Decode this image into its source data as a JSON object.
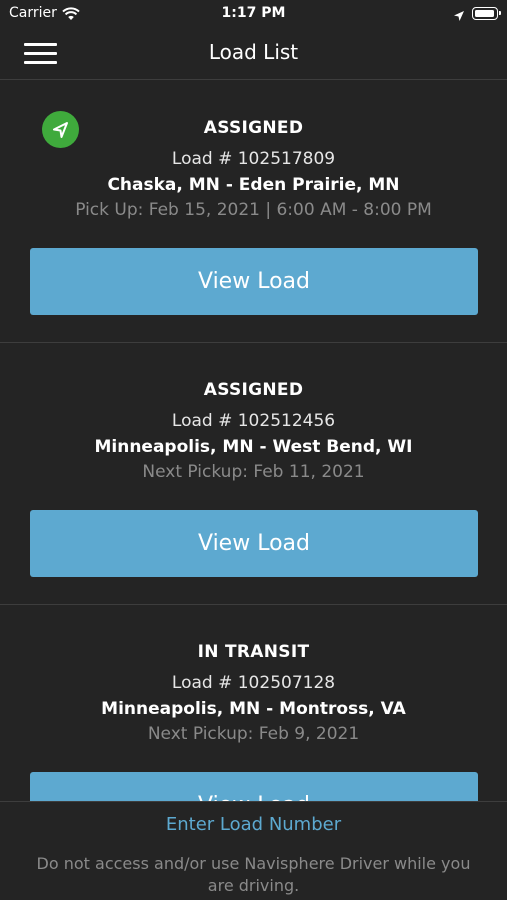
{
  "status_bar": {
    "carrier": "Carrier",
    "time": "1:17 PM"
  },
  "header": {
    "title": "Load List"
  },
  "loads": [
    {
      "status": "ASSIGNED",
      "number": "Load # 102517809",
      "route": "Chaska, MN - Eden Prairie, MN",
      "pickup": "Pick Up: Feb 15, 2021 | 6:00 AM - 8:00 PM",
      "button": "View Load"
    },
    {
      "status": "ASSIGNED",
      "number": "Load # 102512456",
      "route": "Minneapolis, MN - West Bend, WI",
      "pickup": "Next Pickup: Feb 11, 2021",
      "button": "View Load"
    },
    {
      "status": "IN TRANSIT",
      "number": "Load # 102507128",
      "route": "Minneapolis, MN - Montross, VA",
      "pickup": "Next Pickup: Feb 9, 2021",
      "button": "View Load"
    }
  ],
  "footer": {
    "link": "Enter Load Number",
    "note": "Do not access and/or use Navisphere Driver while you are driving."
  },
  "colors": {
    "accent": "#5da9d0",
    "background": "#242424",
    "badge": "#3faa3c",
    "muted": "#8a8a8a"
  },
  "icons": {
    "menu": "hamburger-icon",
    "active_load": "navigation-arrow-icon"
  }
}
